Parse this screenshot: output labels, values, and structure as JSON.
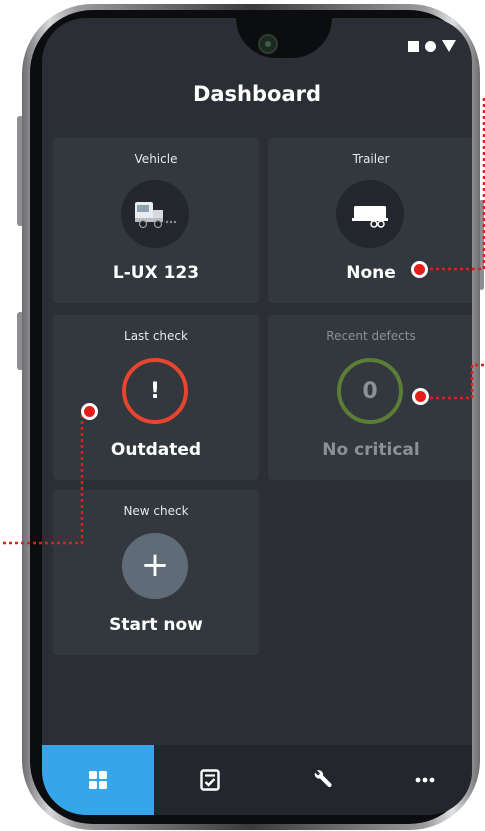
{
  "header": {
    "title": "Dashboard"
  },
  "status_bar": {
    "icons": [
      "square-icon",
      "circle-icon",
      "triangle-icon"
    ]
  },
  "tiles": {
    "vehicle": {
      "label": "Vehicle",
      "value": "L-UX 123",
      "icon": "truck-icon"
    },
    "trailer": {
      "label": "Trailer",
      "value": "None",
      "icon": "trailer-icon"
    },
    "last_check": {
      "label": "Last check",
      "value": "Outdated",
      "badge": "!"
    },
    "recent_defects": {
      "label": "Recent defects",
      "value": "No critical",
      "count": "0"
    },
    "new_check": {
      "label": "New check",
      "value": "Start now",
      "badge": "+"
    }
  },
  "nav": {
    "items": [
      {
        "name": "dashboard",
        "icon": "grid-icon",
        "active": true
      },
      {
        "name": "checks",
        "icon": "checklist-icon",
        "active": false
      },
      {
        "name": "defects",
        "icon": "wrench-icon",
        "active": false
      },
      {
        "name": "more",
        "icon": "more-icon",
        "active": false
      }
    ]
  },
  "colors": {
    "screen_bg": "#2b2f35",
    "tile_bg": "#33373e",
    "accent_blue": "#35a7e8",
    "alert_red": "#e8452e",
    "ok_green": "#5b7d36",
    "annotation_red": "#e31d1a"
  }
}
